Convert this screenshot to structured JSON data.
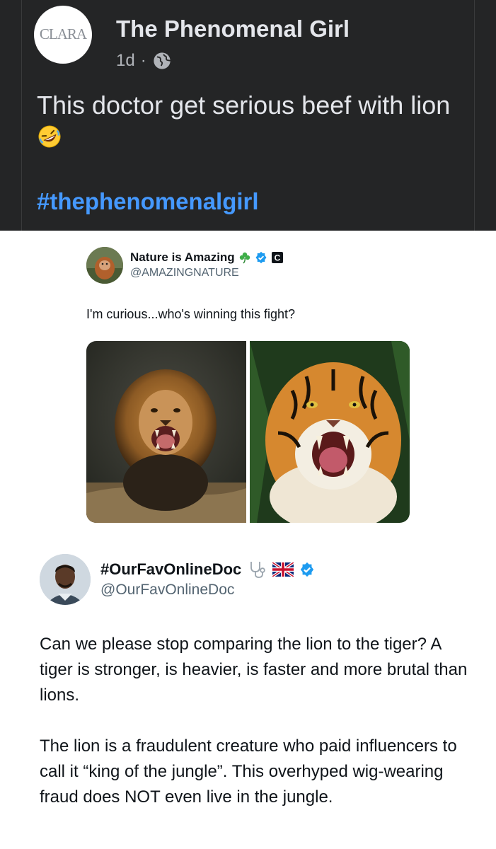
{
  "fb_post": {
    "avatar_logo": "CLARA",
    "author": "The Phenomenal Girl",
    "time": "1d",
    "separator": "·",
    "text": "This doctor get serious beef with lion",
    "hashtag": "#thephenomenalgirl",
    "colors": {
      "background": "#242526",
      "text": "#e4e6eb",
      "hashtag": "#4599ff"
    }
  },
  "tweet1": {
    "author": "Nature is Amazing",
    "handle": "@AMAZINGNATURE",
    "text": "I'm curious...who's winning this fight?",
    "badges": [
      "clover-icon",
      "verified-badge-icon",
      "c-badge-icon"
    ],
    "images": [
      "lion-photo",
      "tiger-photo"
    ]
  },
  "tweet2": {
    "author": "#OurFavOnlineDoc",
    "handle": "@OurFavOnlineDoc",
    "badges": [
      "stethoscope-icon",
      "uk-flag-icon",
      "verified-badge-icon"
    ],
    "paragraph1": "Can we please stop comparing the lion to the tiger? A tiger is stronger, is heavier, is faster and more brutal than lions.",
    "paragraph2": "The lion is a fraudulent creature who paid influencers to call it “king of the jungle”. This overhyped wig-wearing fraud does NOT even live in the jungle.",
    "colors": {
      "verified": "#1d9bf0",
      "text": "#0f1419",
      "handle": "#536471"
    }
  }
}
